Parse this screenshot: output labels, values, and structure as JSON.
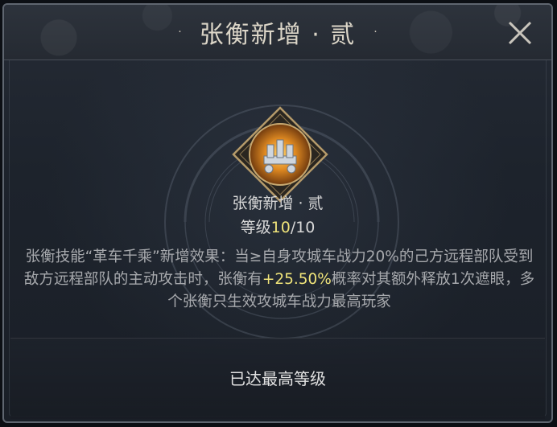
{
  "dialog": {
    "title": "张衡新增 · 贰",
    "title_dot_left": "·",
    "title_dot_right": "·",
    "close_icon": "close-icon"
  },
  "skill": {
    "icon": "siege-chariot-icon",
    "name": "张衡新增 · 贰",
    "level_prefix": "等级",
    "level_current": "10",
    "level_sep_max": "/10",
    "description_pre": "张衡技能“革车千乘”新增效果：当≥自身攻城车战力20%的己方远程部队受到敌方远程部队的主动攻击时，张衡有",
    "description_highlight": "+25.50%",
    "description_post": "概率对其额外释放1次遮眼，多个张衡只生效攻城车战力最高玩家"
  },
  "footer": {
    "status_label": "已达最高等级"
  },
  "colors": {
    "highlight": "#f0e47a",
    "text": "#a7a9ad",
    "title": "#dcd6c8"
  }
}
